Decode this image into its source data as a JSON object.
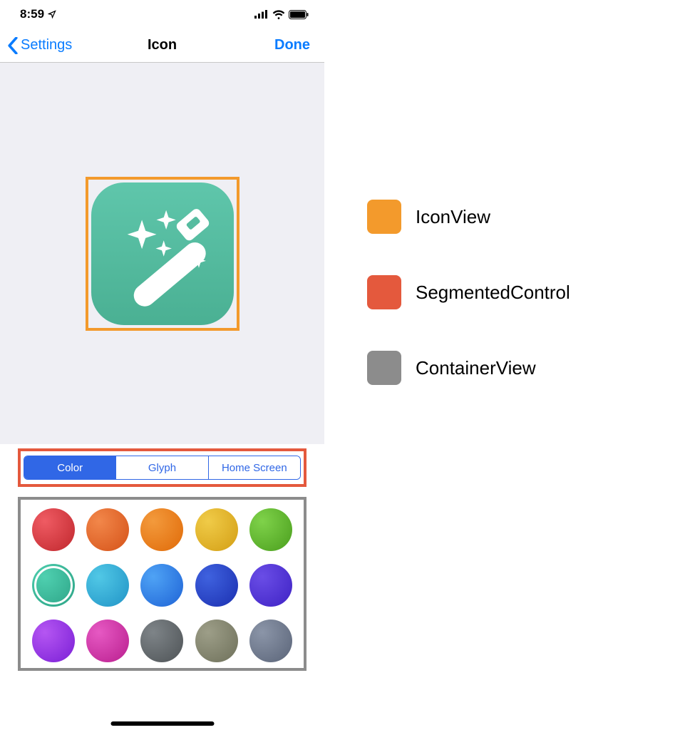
{
  "status_bar": {
    "time": "8:59"
  },
  "nav": {
    "back_label": "Settings",
    "title": "Icon",
    "done_label": "Done"
  },
  "segments": {
    "items": [
      "Color",
      "Glyph",
      "Home Screen"
    ],
    "selected_index": 0
  },
  "color_palette": {
    "selected_index": 5,
    "colors": [
      "radial-gradient(circle at 30% 30%, #ef5b63, #c0272d)",
      "radial-gradient(circle at 30% 30%, #f2874a, #d55218)",
      "radial-gradient(circle at 30% 30%, #f39a3c, #e06a08)",
      "radial-gradient(circle at 30% 30%, #f0cb48, #d39e14)",
      "radial-gradient(circle at 30% 30%, #7fd24a, #4a9e1d)",
      "radial-gradient(circle at 30% 30%, #4fd0b0, #2ba184)",
      "radial-gradient(circle at 30% 30%, #51c8e6, #2093c6)",
      "radial-gradient(circle at 30% 30%, #4fa3f5, #1e63d6)",
      "radial-gradient(circle at 30% 30%, #3f62df, #1b2fb0)",
      "radial-gradient(circle at 30% 30%, #6a4de6, #3e22c4)",
      "radial-gradient(circle at 30% 30%, #b556f2, #7a1fd6)",
      "radial-gradient(circle at 30% 30%, #e659c3, #b91e8e)",
      "radial-gradient(circle at 30% 30%, #7e8488, #4e5356)",
      "radial-gradient(circle at 30% 30%, #9d9e88, #6e705a)",
      "radial-gradient(circle at 30% 30%, #8b95a8, #5a6478)"
    ]
  },
  "annotations": {
    "icon_view": {
      "color": "#f39a2c",
      "label": "IconView"
    },
    "segmented_control": {
      "color": "#e4593d",
      "label": "SegmentedControl"
    },
    "container_view": {
      "color": "#8c8c8c",
      "label": "ContainerView"
    }
  }
}
